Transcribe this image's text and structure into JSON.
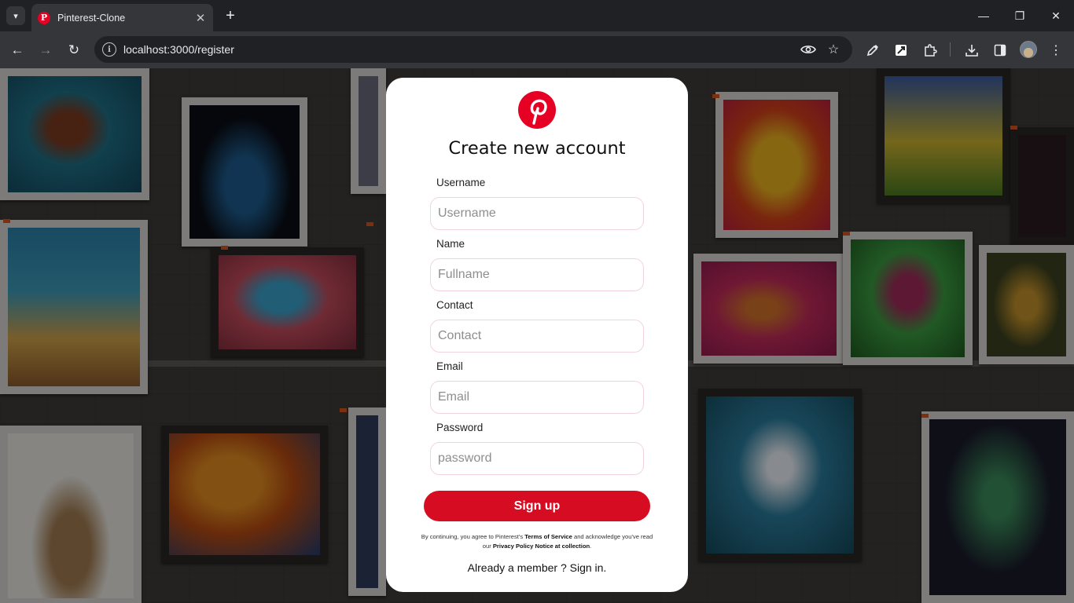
{
  "browser": {
    "tab_title": "Pinterest-Clone",
    "tab_close": "✕",
    "new_tab": "+",
    "url": "localhost:3000/register",
    "win_minimize": "—",
    "win_restore": "❐",
    "win_close": "✕",
    "icons": {
      "tab_search": "chevron-down-icon",
      "back": "arrow-left-icon",
      "forward": "arrow-right-icon",
      "reload": "reload-icon",
      "site_info": "info-icon",
      "eye": "eye-icon",
      "bookmark": "star-icon",
      "eyedropper": "eyedropper-icon",
      "extension_1": "extension-icon",
      "extensions": "puzzle-icon",
      "downloads": "download-icon",
      "side_panel": "side-panel-icon",
      "profile": "avatar",
      "menu": "kebab-menu-icon"
    }
  },
  "form": {
    "title": "Create new account",
    "brand_color": "#e60023",
    "button_color": "#d50c22",
    "fields": [
      {
        "label": "Username",
        "placeholder": "Username",
        "value": ""
      },
      {
        "label": "Name",
        "placeholder": "Fullname",
        "value": ""
      },
      {
        "label": "Contact",
        "placeholder": "Contact",
        "value": ""
      },
      {
        "label": "Email",
        "placeholder": "Email",
        "value": ""
      },
      {
        "label": "Password",
        "placeholder": "password",
        "value": ""
      }
    ],
    "submit_label": "Sign up",
    "terms": {
      "part1": "By continuing, you agree to Pinterest's ",
      "terms_link": "Terms of Service",
      "part2": " and acknowledge you've read our ",
      "privacy_link": "Privacy Policy Notice at collection",
      "part3": "."
    },
    "signin_text": "Already a member ? Sign in."
  }
}
